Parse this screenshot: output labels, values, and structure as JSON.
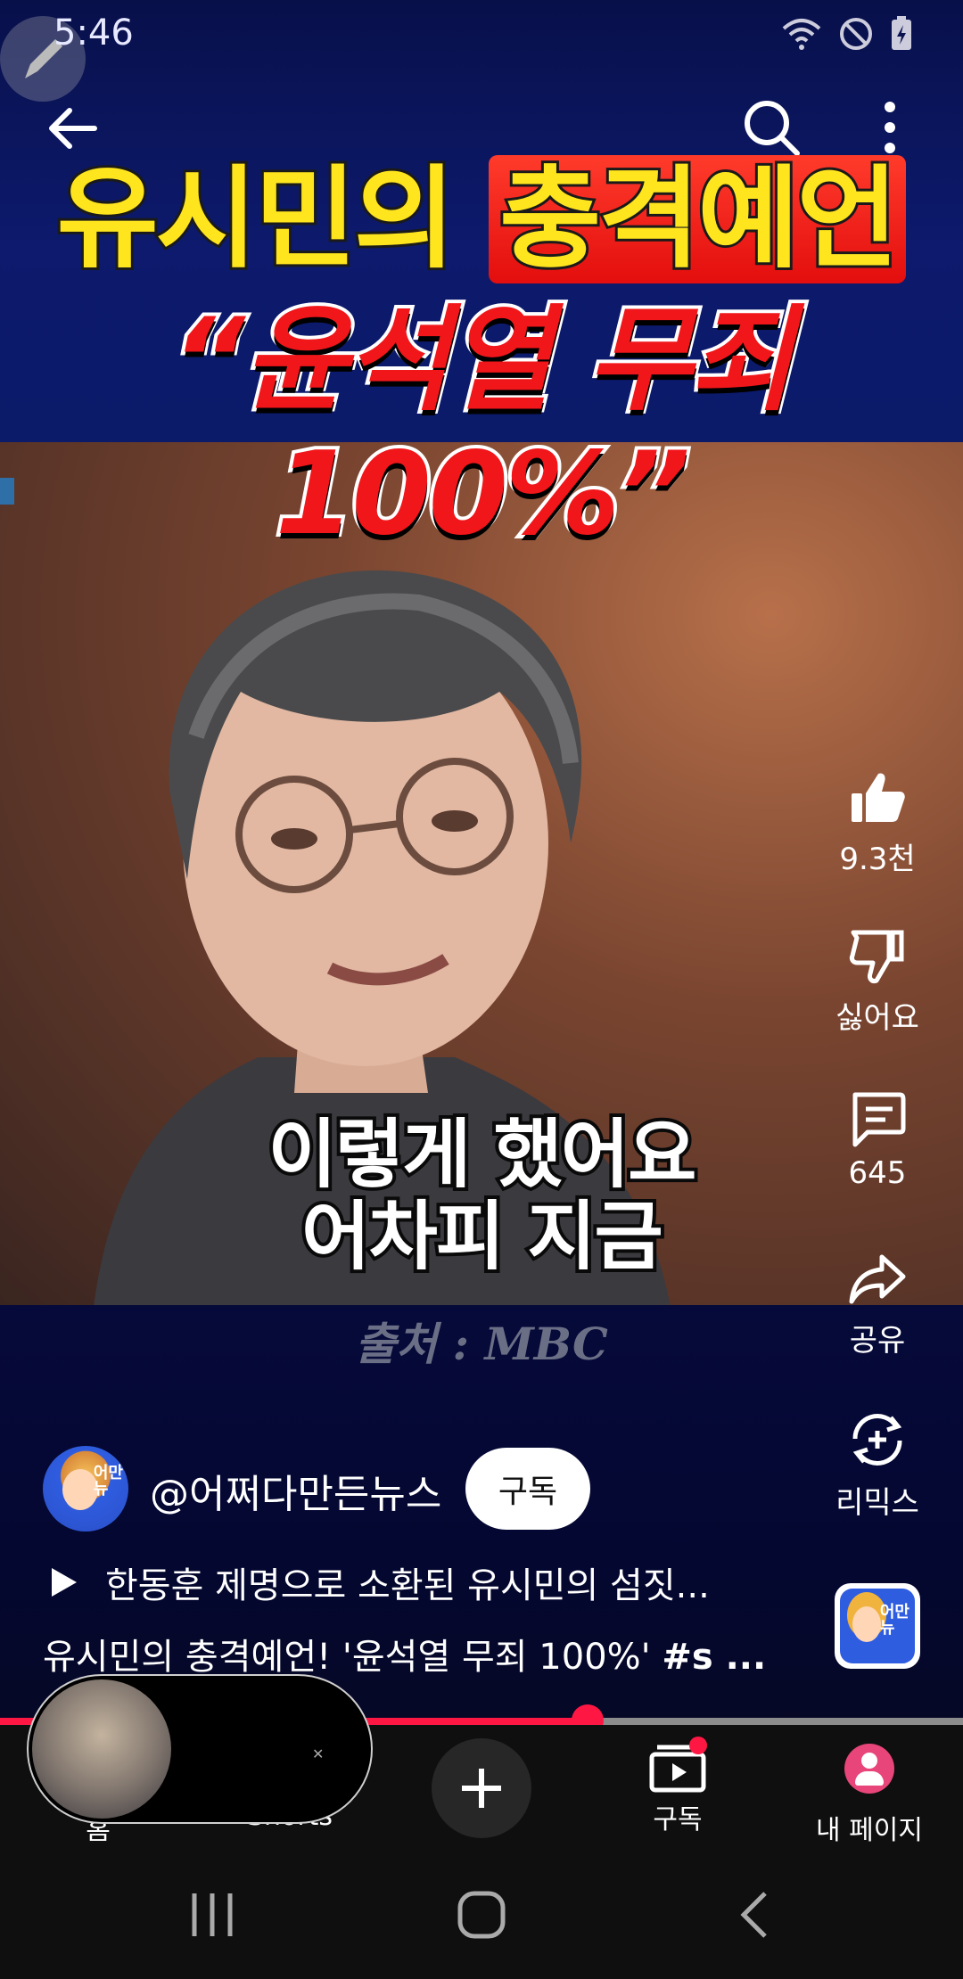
{
  "status": {
    "time": "5:46"
  },
  "video": {
    "title_part1": "유시민의 ",
    "title_part2": "충격예언",
    "title_line2": "“윤석열 무죄 100%”",
    "subtitle_line1": "이렇게 했어요",
    "subtitle_line2": "어차피 지금",
    "source": "출처 : MBC"
  },
  "actions": {
    "like_count": "9.3천",
    "dislike_label": "싫어요",
    "comment_count": "645",
    "share_label": "공유",
    "remix_label": "리믹스"
  },
  "channel": {
    "name": "@어쩌다만든뉴스",
    "subscribe_label": "구독",
    "avatar_tag": "어만\n뉴"
  },
  "playlist": {
    "text": "한동훈 제명으로 소환된 유시민의 섬짓..."
  },
  "description": {
    "text": "유시민의 충격예언! '윤석열 무죄 100%' ",
    "tag": "#s ..."
  },
  "progress": {
    "fraction": 0.61
  },
  "bottom_nav": {
    "home": "홈",
    "shorts": "Shorts",
    "subscriptions": "구독",
    "me": "내 페이지"
  },
  "colors": {
    "accent": "#ff1744",
    "background": "#0b1250"
  }
}
